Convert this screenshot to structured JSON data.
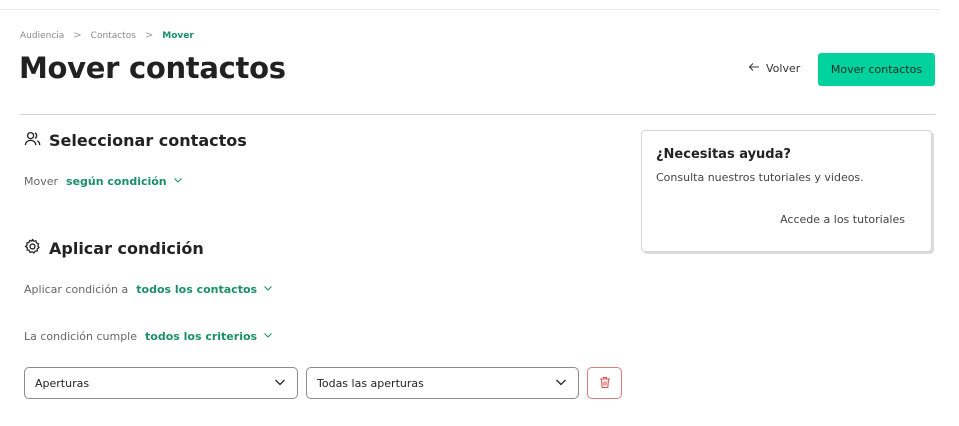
{
  "breadcrumb": {
    "items": [
      "Audiencia",
      "Contactos"
    ],
    "current": "Mover",
    "separator": ">"
  },
  "header": {
    "title": "Mover contactos",
    "back_label": "Volver",
    "primary_label": "Mover contactos"
  },
  "select_section": {
    "title": "Seleccionar contactos",
    "icon": "users-icon",
    "move_label": "Mover",
    "move_value": "según condición"
  },
  "condition_section": {
    "title": "Aplicar condición",
    "icon": "gear-icon",
    "apply_label": "Aplicar condición a",
    "apply_value": "todos los contactos",
    "match_label": "La condición cumple",
    "match_value": "todos los criterios"
  },
  "criteria": {
    "field_value": "Aperturas",
    "operator_value": "Todas las aperturas"
  },
  "help": {
    "title": "¿Necesitas ayuda?",
    "text": "Consulta nuestros tutoriales y videos.",
    "link": "Accede a los tutoriales"
  },
  "colors": {
    "accent": "#00d29e",
    "link_green": "#1b8f6a",
    "danger": "#e07b7b"
  }
}
